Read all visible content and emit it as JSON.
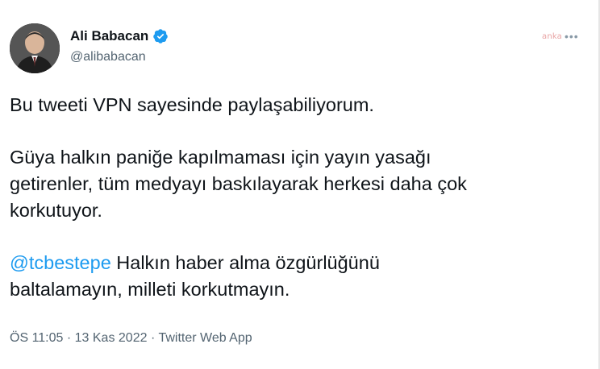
{
  "author": {
    "display_name": "Ali Babacan",
    "handle": "@alibabacan",
    "verified": true,
    "avatar_icon": "profile-photo"
  },
  "watermark": "anka",
  "more_label": "•••",
  "tweet": {
    "line1": "Bu tweeti VPN sayesinde paylaşabiliyorum.",
    "para2": [
      "Güya halkın paniğe kapılmaması için yayın yasağı",
      "getirenler, tüm medyayı baskılayarak herkesi daha çok",
      "korkutuyor."
    ],
    "mention": "@tcbestepe",
    "para3_rest": " Halkın haber alma özgürlüğünü",
    "para3_line2": "baltalamayın, milleti korkutmayın."
  },
  "meta": {
    "time": "ÖS 11:05",
    "sep1": " · ",
    "date": "13 Kas 2022",
    "sep2": " · ",
    "source": "Twitter Web App"
  },
  "colors": {
    "link": "#1d9bf0",
    "verified": "#1d9bf0",
    "secondary_text": "#536471"
  }
}
